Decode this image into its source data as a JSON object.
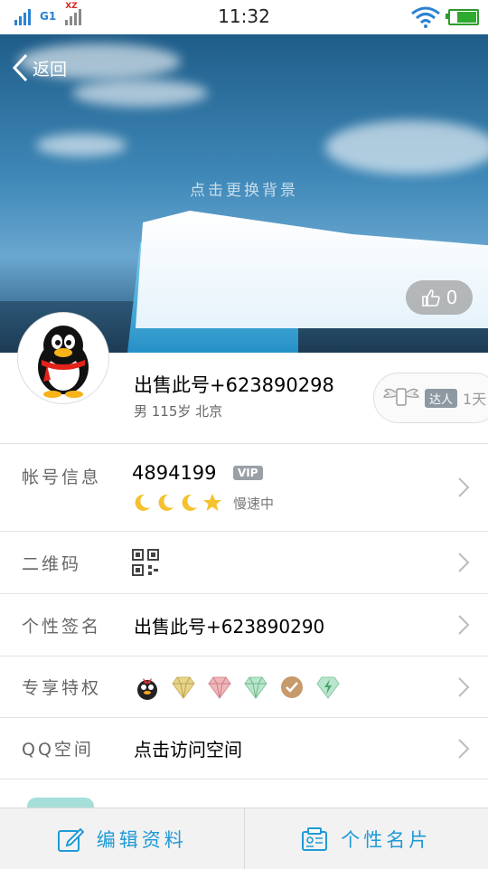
{
  "status_bar": {
    "network": "G1",
    "roaming": "XZ",
    "time": "11:32"
  },
  "header": {
    "back_label": "返回",
    "change_background_hint": "点击更换背景",
    "like_count": "0"
  },
  "profile": {
    "name": "出售此号+623890298",
    "meta": "男 115岁 北京",
    "talent_badge": "达人",
    "talent_days": "1天"
  },
  "rows": {
    "account": {
      "label": "帐号信息",
      "number": "4894199",
      "vip": "VIP",
      "status": "慢速中"
    },
    "qrcode": {
      "label": "二维码"
    },
    "signature": {
      "label": "个性签名",
      "value": "出售此号+623890290"
    },
    "privilege": {
      "label": "专享特权"
    },
    "qzone": {
      "label": "QQ空间",
      "value": "点击访问空间"
    }
  },
  "bottom_bar": {
    "edit_label": "编辑资料",
    "card_label": "个性名片"
  },
  "colors": {
    "accent": "#1f9ad6",
    "vip_gray": "#9aa0a6",
    "moon": "#f5c12e"
  }
}
